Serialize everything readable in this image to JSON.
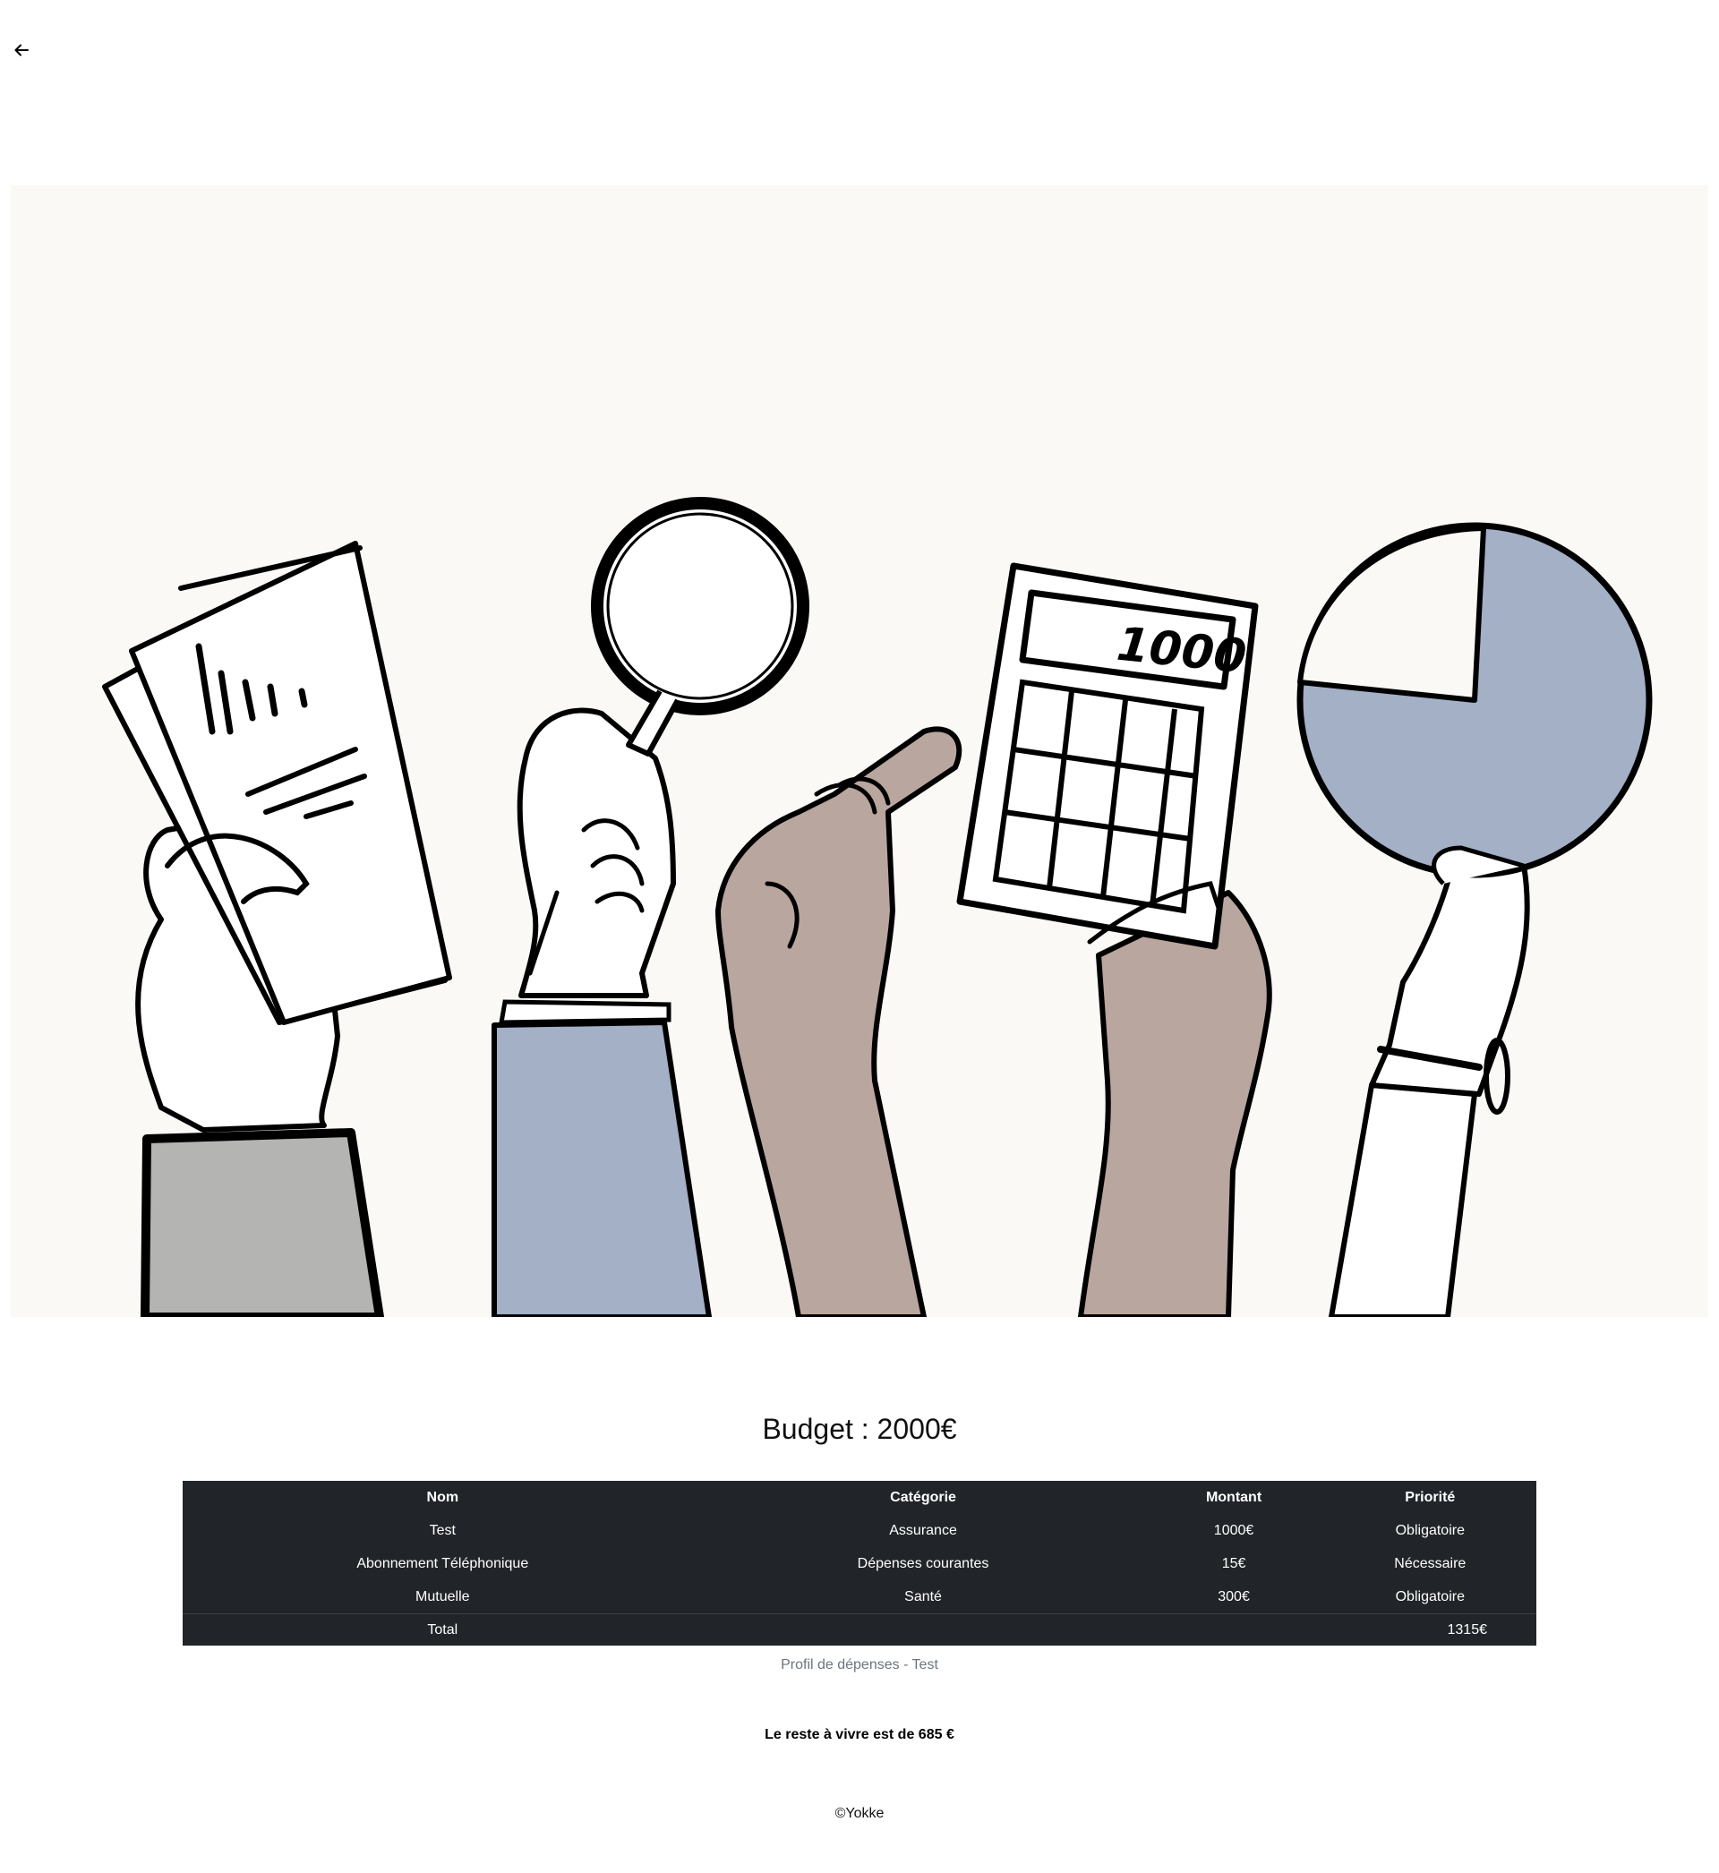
{
  "nav": {
    "back_icon": "arrow-left-icon"
  },
  "hero": {
    "illustration": "hands-holding-finance-items",
    "colors": {
      "background": "#faf9f5",
      "blue": "#a3b0c6",
      "brown": "#b9a69e",
      "gray": "#b4b5b2",
      "line": "#000000"
    },
    "calculator_display": "1000"
  },
  "budget": {
    "title": "Budget : 2000€"
  },
  "table": {
    "headers": [
      "Nom",
      "Catégorie",
      "Montant",
      "Priorité"
    ],
    "rows": [
      {
        "nom": "Test",
        "categorie": "Assurance",
        "montant": "1000€",
        "priorite": "Obligatoire"
      },
      {
        "nom": "Abonnement Téléphonique",
        "categorie": "Dépenses courantes",
        "montant": "15€",
        "priorite": "Nécessaire"
      },
      {
        "nom": "Mutuelle",
        "categorie": "Santé",
        "montant": "300€",
        "priorite": "Obligatoire"
      }
    ],
    "total_label": "Total",
    "total_value": "1315€",
    "background": "#212529"
  },
  "caption": "Profil de dépenses - Test",
  "reste": "Le reste à vivre est de 685 €",
  "footer": "©Yokke"
}
